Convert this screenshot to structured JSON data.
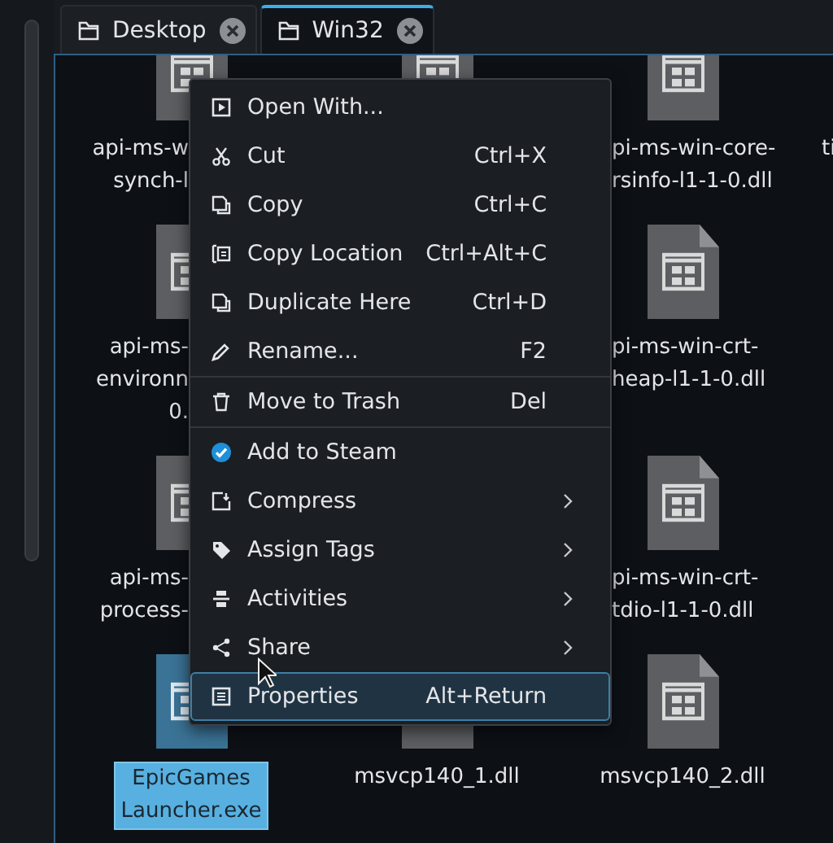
{
  "tabs": [
    {
      "label": "Desktop",
      "selected": false
    },
    {
      "label": "Win32",
      "selected": true
    }
  ],
  "files": [
    [
      {
        "lines": [
          "api-ms-w",
          "synch-l"
        ],
        "cut": true,
        "selected": false
      },
      {
        "selected": false
      },
      {
        "lines": [
          "pi-ms-win-core-",
          "rsinfo-l1-1-0.dll"
        ],
        "cut": true,
        "selected": false
      },
      {
        "lines": [
          "ti"
        ],
        "cut": true,
        "selected": false
      }
    ],
    [
      {
        "lines": [
          "api-ms-",
          "environn",
          "0."
        ],
        "cut": true,
        "selected": false
      },
      {
        "lines": [
          "pi-ms-win-crt-",
          "heap-l1-1-0.dll"
        ],
        "cut": true,
        "selected": false
      }
    ],
    [
      {
        "lines": [
          "api-ms-",
          "process-"
        ],
        "cut": true,
        "selected": false
      },
      {
        "lines": [
          "pi-ms-win-crt-",
          "tdio-l1-1-0.dll"
        ],
        "cut": true,
        "selected": false
      }
    ],
    [
      {
        "lines": [
          "EpicGames",
          "Launcher.exe"
        ],
        "cut": false,
        "selected": true
      },
      {
        "lines": [
          "msvcp140_1.dll"
        ],
        "cut": false,
        "selected": false
      },
      {
        "lines": [
          "msvcp140_2.dll"
        ],
        "cut": false,
        "selected": false
      }
    ]
  ],
  "menu": [
    {
      "label": "Open With...",
      "selected": false,
      "submenu": false
    },
    {
      "label": "Cut",
      "shortcut": "Ctrl+X",
      "selected": false,
      "submenu": false
    },
    {
      "label": "Copy",
      "shortcut": "Ctrl+C",
      "selected": false,
      "submenu": false
    },
    {
      "label": "Copy Location",
      "shortcut": "Ctrl+Alt+C",
      "selected": false,
      "submenu": false
    },
    {
      "label": "Duplicate Here",
      "shortcut": "Ctrl+D",
      "selected": false,
      "submenu": false
    },
    {
      "label": "Rename...",
      "shortcut": "F2",
      "selected": false,
      "submenu": false
    },
    {
      "kind": "separator"
    },
    {
      "label": "Move to Trash",
      "shortcut": "Del",
      "selected": false,
      "submenu": false
    },
    {
      "kind": "separator"
    },
    {
      "label": "Add to Steam",
      "selected": false,
      "submenu": false
    },
    {
      "label": "Compress",
      "selected": false,
      "submenu": true
    },
    {
      "label": "Assign Tags",
      "selected": false,
      "submenu": true
    },
    {
      "label": "Activities",
      "selected": false,
      "submenu": true
    },
    {
      "label": "Share",
      "selected": false,
      "submenu": true
    },
    {
      "label": "Properties",
      "shortcut": "Alt+Return",
      "selected": true,
      "submenu": false
    }
  ]
}
